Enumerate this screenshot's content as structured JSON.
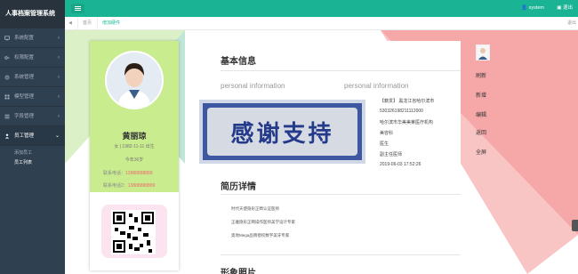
{
  "app": {
    "title": "人事档案管理系统"
  },
  "sidebar": {
    "items": [
      {
        "label": "系统配置",
        "icon": "monitor-icon",
        "arrow": "‹"
      },
      {
        "label": "权限配置",
        "icon": "key-icon",
        "arrow": "‹"
      },
      {
        "label": "系统管理",
        "icon": "gear-icon",
        "arrow": "‹"
      },
      {
        "label": "模型管理",
        "icon": "grid-icon",
        "arrow": "‹"
      },
      {
        "label": "字段管理",
        "icon": "list-icon",
        "arrow": "‹"
      },
      {
        "label": "员工管理",
        "icon": "people-icon",
        "arrow": "⌄"
      }
    ],
    "subitems": [
      {
        "label": "添加员工"
      },
      {
        "label": "员工列表"
      }
    ]
  },
  "topbar": {
    "user": "system",
    "exit": "退出"
  },
  "tabs": {
    "home": "首页",
    "current": "增加硬件",
    "back": "◀",
    "forward": "退出"
  },
  "profile": {
    "name": "黄丽琼",
    "gender_birth": "女 | 1982-11-11 出生",
    "age": "今年36岁",
    "phone1_label": "联系电话：",
    "phone1": "13888888888",
    "phone2_label": "联系电话2：",
    "phone2": "13888888889"
  },
  "basic": {
    "title": "基本信息",
    "en_left": "personal information",
    "en_right": "personal information",
    "rows": [
      "【籍贯】 黑龙江省哈尔滨市",
      "530326198211112000",
      "哈尔滨市华美美莱医疗机构",
      "美容科",
      "医生",
      "副主任医师",
      "2019-06-03 17:52:26"
    ]
  },
  "resume": {
    "title": "简历详情",
    "items": [
      "时代天使隐形正畸认证医师",
      "正雅隐形正畸操作医师美学设计专家",
      "奥地Mega品牌授权数字美牙专家"
    ]
  },
  "photos": {
    "title": "形象照片"
  },
  "actions": {
    "refresh": "刷新",
    "add": "新增",
    "edit": "编辑",
    "back": "返回",
    "fullscreen": "全屏"
  },
  "watermark": {
    "text": "感谢支持"
  },
  "colors": {
    "accent": "#1ab394",
    "sidebar": "#2f4050",
    "card_green": "#c9ec8f",
    "phone_red": "#f06b6b"
  }
}
